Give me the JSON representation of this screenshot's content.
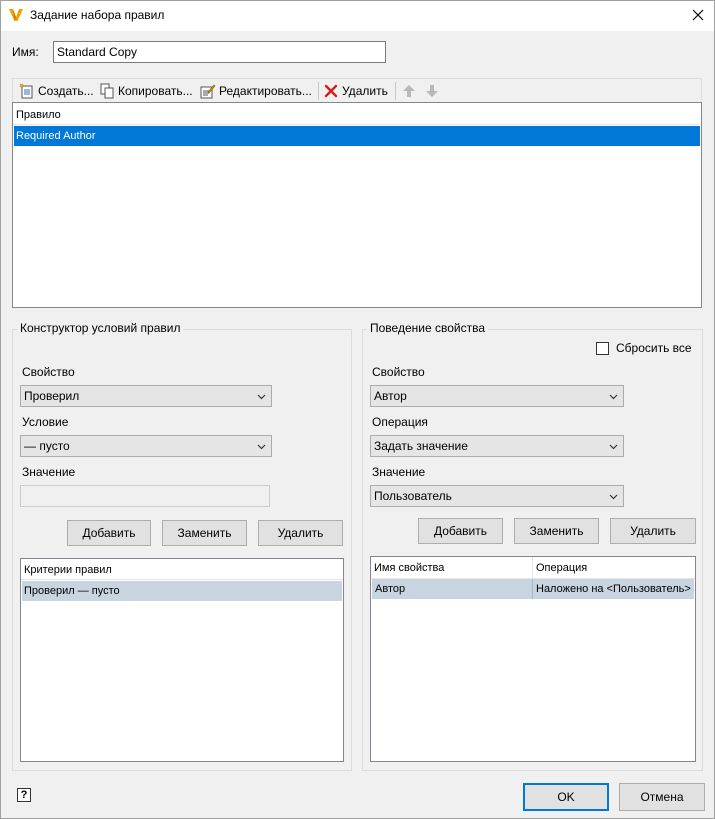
{
  "window": {
    "title": "Задание набора правил",
    "icon": "autodesk-vault-icon",
    "close_glyph": "✕"
  },
  "name_field": {
    "label": "Имя:",
    "value": "Standard Copy"
  },
  "toolbar": {
    "create": "Создать...",
    "copy": "Копировать...",
    "edit": "Редактировать...",
    "delete": "Удалить"
  },
  "rules_list": {
    "header": "Правило",
    "items": [
      "Required Author"
    ]
  },
  "condition_builder": {
    "title": "Конструктор условий правил",
    "property_label": "Свойство",
    "property_value": "Проверил",
    "condition_label": "Условие",
    "condition_value": "— пусто",
    "value_label": "Значение",
    "value_text": "",
    "add": "Добавить",
    "replace": "Заменить",
    "delete": "Удалить",
    "criteria_header": "Критерии правил",
    "criteria_items": [
      "Проверил — пусто"
    ]
  },
  "property_behavior": {
    "title": "Поведение свойства",
    "reset_all": "Сбросить все",
    "property_label": "Свойство",
    "property_value": "Автор",
    "operation_label": "Операция",
    "operation_value": "Задать значение",
    "value_label": "Значение",
    "value_value": "Пользователь",
    "add": "Добавить",
    "replace": "Заменить",
    "delete": "Удалить",
    "grid_headers": [
      "Имя свойства",
      "Операция"
    ],
    "grid_rows": [
      [
        "Автор",
        "Наложено на <Пользователь>"
      ]
    ]
  },
  "footer": {
    "help": "?",
    "ok": "OK",
    "cancel": "Отмена"
  },
  "colors": {
    "selection": "#0078d7",
    "selection_inactive": "#c8d4e0",
    "accent": "#f4a100"
  }
}
